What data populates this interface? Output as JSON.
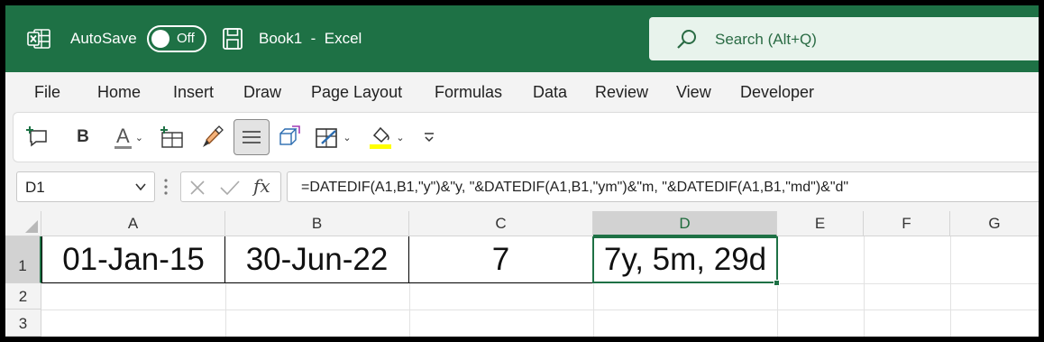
{
  "titlebar": {
    "autosave_label": "AutoSave",
    "autosave_state": "Off",
    "doc_title": "Book1  -  Excel",
    "search_placeholder": "Search (Alt+Q)",
    "brand_color": "#1e7145"
  },
  "menu": {
    "tabs": [
      "File",
      "Home",
      "Insert",
      "Draw",
      "Page Layout",
      "Formulas",
      "Data",
      "Review",
      "View",
      "Developer"
    ]
  },
  "ribbon": {
    "icons": [
      "new-comment-icon",
      "bold-icon",
      "font-color-icon",
      "insert-row-icon",
      "format-painter-icon",
      "align-center-icon",
      "3d-model-icon",
      "borders-icon",
      "fill-color-icon",
      "customize-toolbar-icon"
    ],
    "bold_label": "B",
    "font_color_label": "A",
    "fill_highlight_color": "#ffff00"
  },
  "formula_bar": {
    "name_box": "D1",
    "fx_label": "fx",
    "formula": "=DATEDIF(A1,B1,\"y\")&\"y, \"&DATEDIF(A1,B1,\"ym\")&\"m, \"&DATEDIF(A1,B1,\"md\")&\"d\""
  },
  "sheet": {
    "columns": [
      "A",
      "B",
      "C",
      "D",
      "E",
      "F",
      "G"
    ],
    "rows": [
      "1",
      "2",
      "3"
    ],
    "selected_cell": "D1",
    "cells": {
      "A1": "01-Jan-15",
      "B1": "30-Jun-22",
      "C1": "7",
      "D1": "7y, 5m, 29d"
    }
  }
}
